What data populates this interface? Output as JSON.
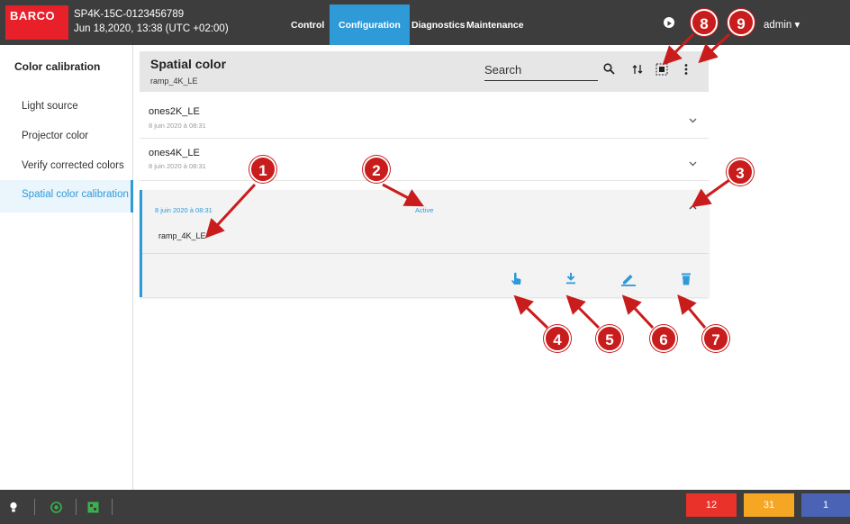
{
  "topbar": {
    "logo": "BARCO",
    "device_name": "SP4K-15C-0123456789",
    "device_date": "Jun 18,2020, 13:38 (UTC +02:00)",
    "nav": [
      "Control",
      "Configuration",
      "Diagnostics",
      "Maintenance"
    ],
    "active_nav": "Configuration",
    "user": "admin"
  },
  "sidebar": {
    "title": "Color calibration",
    "items": [
      "Light source",
      "Projector color",
      "Verify corrected colors",
      "Spatial color calibration"
    ],
    "active_item": "Spatial color calibration"
  },
  "header": {
    "title": "Spatial color",
    "subtitle": "ramp_4K_LE",
    "search_placeholder": "Search"
  },
  "rows": [
    {
      "name": "ones2K_LE",
      "date": "8 juin 2020 à 08:31"
    },
    {
      "name": "ones4K_LE",
      "date": "8 juin 2020 à 08:31"
    }
  ],
  "expanded": {
    "date": "8 juin 2020 à 08:31",
    "status": "Active",
    "name": "ramp_4K_LE"
  },
  "callouts": [
    "1",
    "2",
    "3",
    "4",
    "5",
    "6",
    "7",
    "8",
    "9"
  ],
  "footer": {
    "badges": [
      "12",
      "31",
      "1"
    ],
    "badge_colors": [
      "#e8322a",
      "#f5a623",
      "#4a63b5"
    ]
  },
  "colors": {
    "accent": "#2f9ad8",
    "brand": "#e8202a",
    "callout": "#c91c1c"
  }
}
